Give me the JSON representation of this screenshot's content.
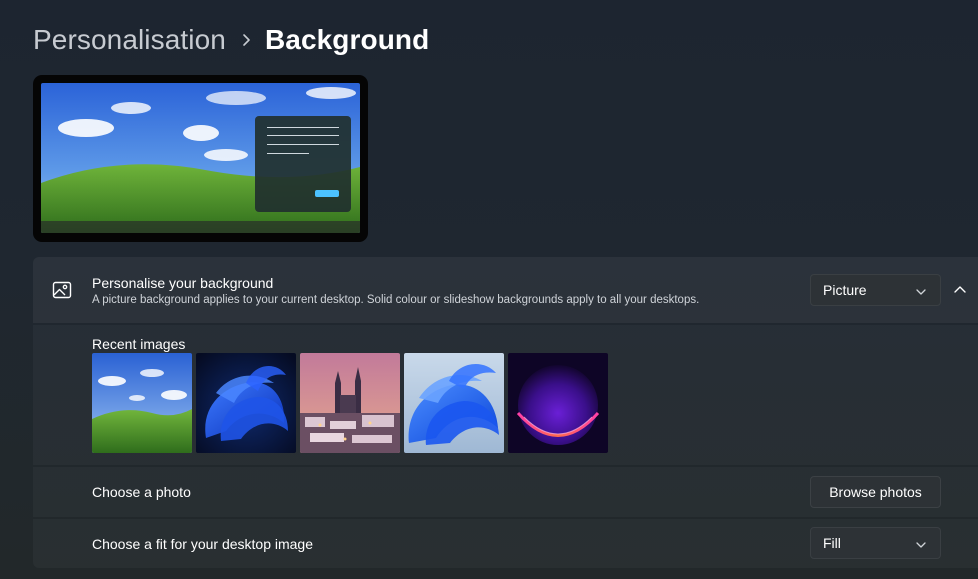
{
  "breadcrumb": {
    "parent": "Personalisation",
    "current": "Background"
  },
  "background_section": {
    "title": "Personalise your background",
    "description": "A picture background applies to your current desktop. Solid colour or slideshow backgrounds apply to all your desktops.",
    "type_selected": "Picture",
    "icon": "image-icon",
    "expanded": true
  },
  "recent_images": {
    "label": "Recent images",
    "items": [
      {
        "name": "bliss-hills"
      },
      {
        "name": "blue-bloom-dark"
      },
      {
        "name": "prague-night"
      },
      {
        "name": "blue-bloom-light"
      },
      {
        "name": "purple-glow"
      }
    ]
  },
  "choose_photo": {
    "label": "Choose a photo",
    "button": "Browse photos"
  },
  "choose_fit": {
    "label": "Choose a fit for your desktop image",
    "selected": "Fill"
  },
  "colors": {
    "accent": "#4cc2ff",
    "background": "#1f2730",
    "card": "#2a3038"
  }
}
